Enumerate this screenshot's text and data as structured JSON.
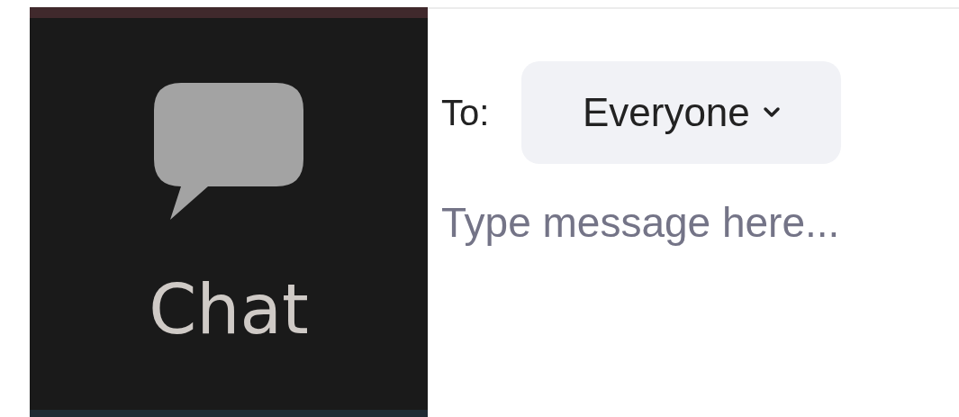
{
  "toolbar_button": {
    "label": "Chat"
  },
  "recipient": {
    "label": "To:",
    "value": "Everyone"
  },
  "message_field": {
    "placeholder": "Type message here..."
  }
}
